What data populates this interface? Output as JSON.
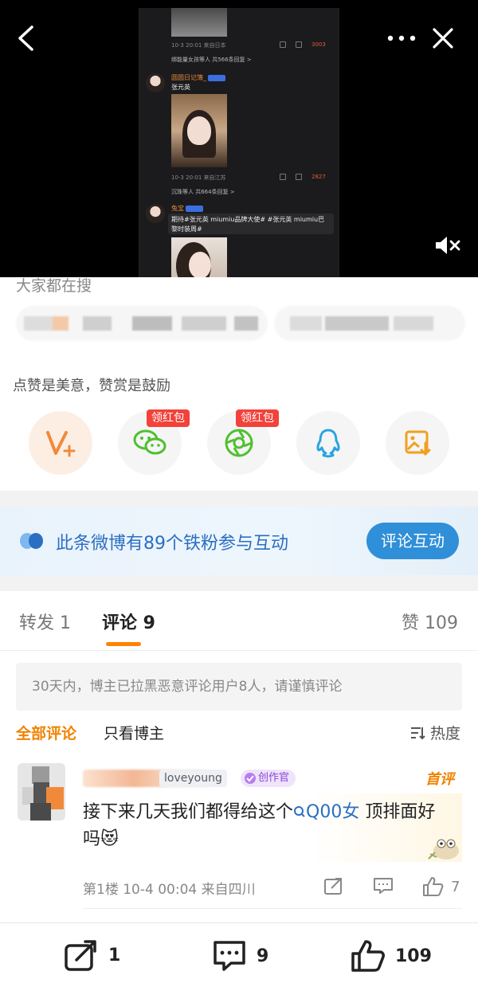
{
  "top": {
    "inner_post": {
      "meta1": "10-3 20:01 来自日本",
      "likes1": "3003",
      "replies1": "绑能量女孩等人  共566条回复 >",
      "user2": "圆圆日记簿_",
      "text2": "张元英",
      "meta2": "10-3 20:01 来自江苏",
      "likes2": "2827",
      "replies2": "沉珠等人  共664条回复 >",
      "user3": "兔宝",
      "text3": "期待#张元英 miumiu品牌大使# #张元英 miumiu巴黎时装周#"
    }
  },
  "search": {
    "title": "大家都在搜"
  },
  "reward": {
    "tip": "点赞是美意，赞赏是鼓励",
    "red_tag": "领红包",
    "targets": [
      {
        "name": "vip-reward",
        "icon": "v-plus-icon"
      },
      {
        "name": "wechat",
        "icon": "wechat-icon",
        "tag": true
      },
      {
        "name": "moments",
        "icon": "moments-icon",
        "tag": true
      },
      {
        "name": "qq",
        "icon": "qq-icon"
      },
      {
        "name": "save-image",
        "icon": "image-download-icon"
      }
    ]
  },
  "fans": {
    "text": "此条微博有89个铁粉参与互动",
    "button": "评论互动"
  },
  "tabs": {
    "repost": "转发 1",
    "comment": "评论 9",
    "like": "赞 109"
  },
  "notice": "30天内，博主已拉黑恶意评论用户8人，请谨慎评论",
  "filters": {
    "all": "全部评论",
    "only_author": "只看博主",
    "sort": "热度"
  },
  "comment": {
    "name_suffix": "loveyoung",
    "badge": "创作官",
    "first": "首评",
    "text_before": "接下来几天我们都得给这个",
    "text_link": "Q00女",
    "text_after": " 顶排面好吗😻",
    "meta": "第1楼  10-4 00:04  来自四川",
    "likes": "7"
  },
  "bottom": {
    "repost": "1",
    "comment": "9",
    "like": "109"
  },
  "colors": {
    "accent": "#ff8200",
    "link": "#2b6fc2",
    "red": "#f2423a"
  }
}
